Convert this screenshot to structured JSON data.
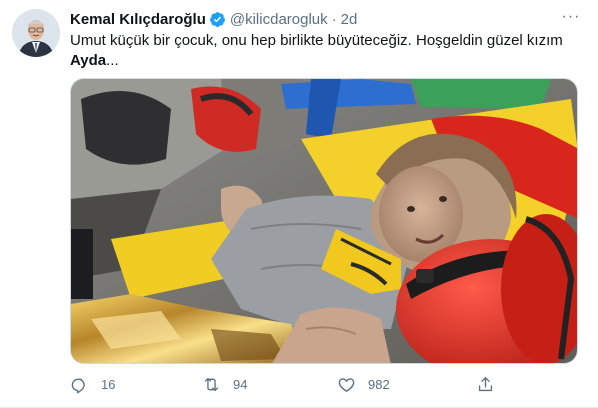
{
  "tweet": {
    "author_name": "Kemal Kılıçdaroğlu",
    "handle": "@kilicdarogluk",
    "separator": "·",
    "time": "2d",
    "more": "···",
    "text_main": "Umut küçük bir çocuk, onu hep birlikte büyüteceğiz. Hoşgeldin güzel kızım ",
    "text_bold": "Ayda",
    "text_tail": "...",
    "verified_icon": "verified-badge-icon",
    "accent_color": "#1da1f2"
  },
  "actions": {
    "reply_count": "16",
    "retweet_count": "94",
    "like_count": "982",
    "reply_icon": "reply-icon",
    "retweet_icon": "retweet-icon",
    "like_icon": "heart-icon",
    "share_icon": "share-icon"
  }
}
